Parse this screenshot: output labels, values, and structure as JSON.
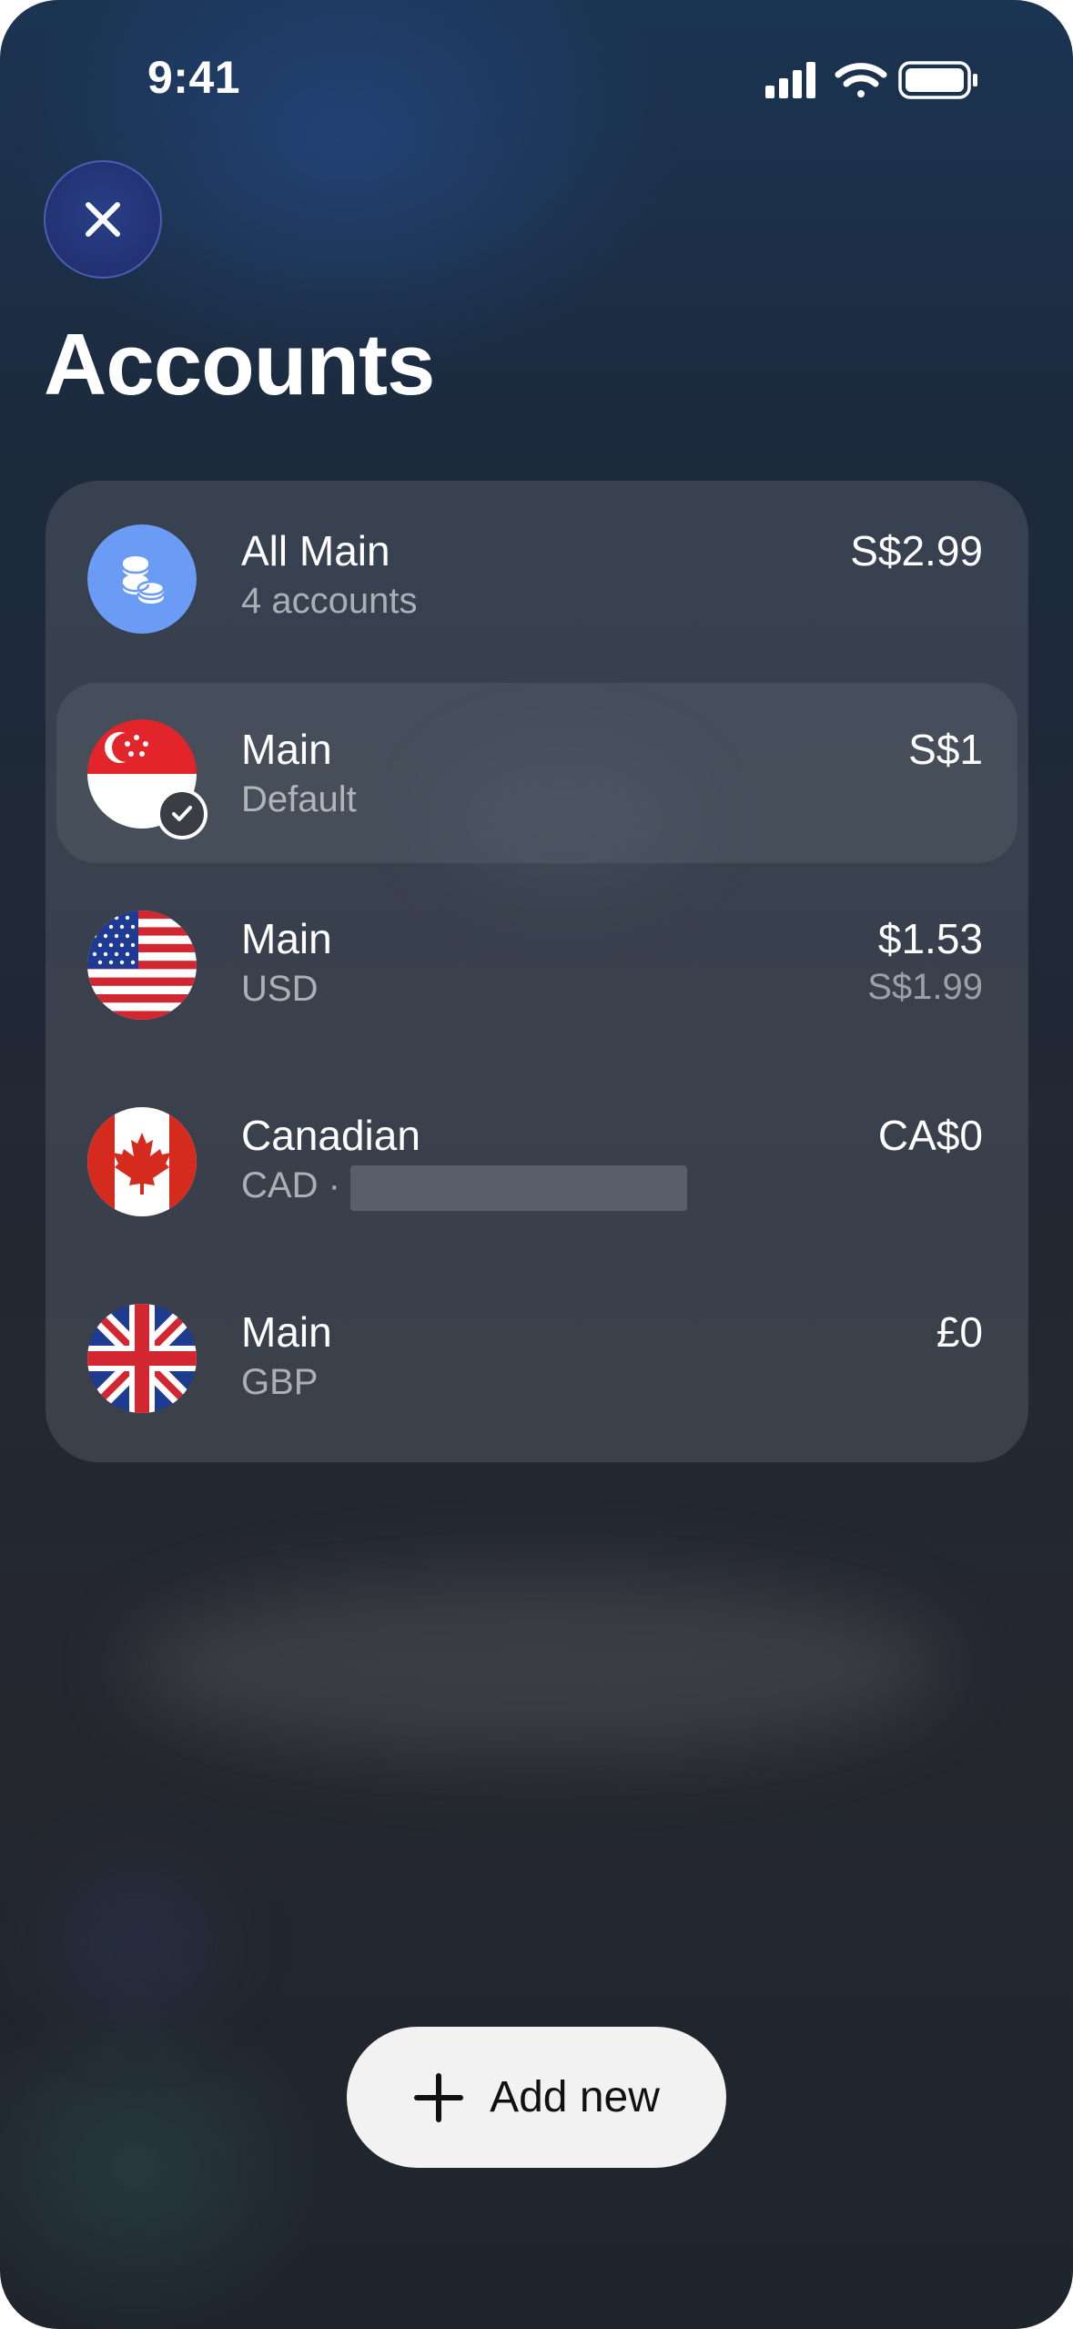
{
  "status_bar": {
    "time": "9:41"
  },
  "page": {
    "title": "Accounts"
  },
  "accounts": [
    {
      "title": "All Main",
      "subtitle": "4 accounts",
      "amount": "S$2.99",
      "icon": "coins-icon"
    },
    {
      "title": "Main",
      "subtitle": "Default",
      "amount": "S$1",
      "icon": "singapore-flag-icon",
      "selected": true
    },
    {
      "title": "Main",
      "subtitle": "USD",
      "amount": "$1.53",
      "amount_secondary": "S$1.99",
      "icon": "us-flag-icon"
    },
    {
      "title": "Canadian",
      "subtitle": "CAD ·",
      "amount": "CA$0",
      "icon": "canada-flag-icon"
    },
    {
      "title": "Main",
      "subtitle": "GBP",
      "amount": "£0",
      "icon": "uk-flag-icon"
    }
  ],
  "actions": {
    "add_new": "Add new"
  },
  "colors": {
    "accent": "#6b9cf5",
    "background": "#1f2730",
    "button": "#f2f2f2"
  }
}
